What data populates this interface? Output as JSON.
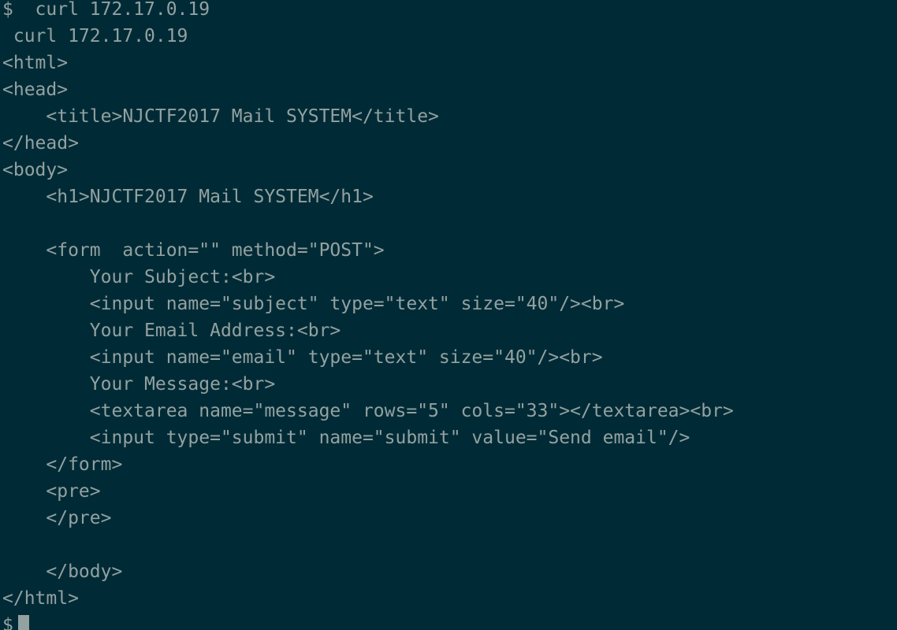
{
  "terminal": {
    "prompt_symbol": "$",
    "lines": [
      "$  curl 172.17.0.19",
      " curl 172.17.0.19",
      "<html>",
      "<head>",
      "    <title>NJCTF2017 Mail SYSTEM</title>",
      "</head>",
      "<body>",
      "    <h1>NJCTF2017 Mail SYSTEM</h1>",
      "",
      "    <form  action=\"\" method=\"POST\">",
      "        Your Subject:<br>",
      "        <input name=\"subject\" type=\"text\" size=\"40\"/><br>",
      "        Your Email Address:<br>",
      "        <input name=\"email\" type=\"text\" size=\"40\"/><br>",
      "        Your Message:<br>",
      "        <textarea name=\"message\" rows=\"5\" cols=\"33\"></textarea><br>",
      "        <input type=\"submit\" name=\"submit\" value=\"Send email\"/>",
      "    </form>",
      "    <pre>",
      "    </pre>",
      "",
      "    </body>",
      "</html>"
    ]
  },
  "colors": {
    "background": "#002b36",
    "foreground": "#93a1a1"
  }
}
